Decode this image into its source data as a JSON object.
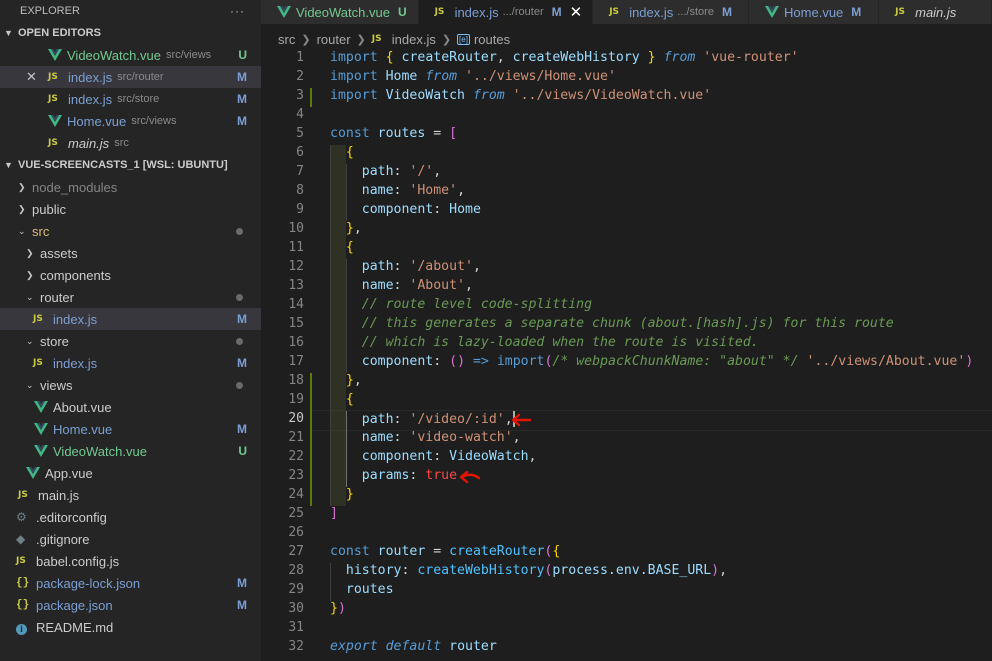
{
  "sidebar": {
    "title": "EXPLORER",
    "more": "···",
    "open_editors": {
      "label": "OPEN EDITORS",
      "items": [
        {
          "name": "VideoWatch.vue",
          "desc": "src/views",
          "badge": "U",
          "icon": "vue-icon"
        },
        {
          "name": "index.js",
          "desc": "src/router",
          "badge": "M",
          "icon": "js-icon"
        },
        {
          "name": "index.js",
          "desc": "src/store",
          "badge": "M",
          "icon": "js-icon"
        },
        {
          "name": "Home.vue",
          "desc": "src/views",
          "badge": "M",
          "icon": "vue-icon"
        },
        {
          "name": "main.js",
          "desc": "src",
          "badge": "",
          "icon": "js-icon"
        }
      ]
    },
    "workspace": {
      "label": "VUE-SCREENCASTS_1 [WSL: UBUNTU]",
      "items": [
        {
          "name": "node_modules"
        },
        {
          "name": "public"
        },
        {
          "name": "src"
        },
        {
          "name": "assets"
        },
        {
          "name": "components"
        },
        {
          "name": "router"
        },
        {
          "name": "index.js",
          "badge": "M"
        },
        {
          "name": "store"
        },
        {
          "name": "index.js",
          "badge": "M"
        },
        {
          "name": "views"
        },
        {
          "name": "About.vue"
        },
        {
          "name": "Home.vue",
          "badge": "M"
        },
        {
          "name": "VideoWatch.vue",
          "badge": "U"
        },
        {
          "name": "App.vue"
        },
        {
          "name": "main.js"
        },
        {
          "name": ".editorconfig"
        },
        {
          "name": ".gitignore"
        },
        {
          "name": "babel.config.js"
        },
        {
          "name": "package-lock.json",
          "badge": "M"
        },
        {
          "name": "package.json",
          "badge": "M"
        },
        {
          "name": "README.md"
        }
      ]
    }
  },
  "tabs": [
    {
      "label": "VideoWatch.vue",
      "ext": "",
      "badge": "U"
    },
    {
      "label": "index.js",
      "ext": ".../router",
      "badge": "M"
    },
    {
      "label": "index.js",
      "ext": ".../store",
      "badge": "M"
    },
    {
      "label": "Home.vue",
      "ext": "",
      "badge": "M"
    },
    {
      "label": "main.js",
      "ext": "",
      "badge": ""
    }
  ],
  "breadcrumb": [
    "src",
    "router",
    "index.js",
    "routes"
  ],
  "editor": {
    "line_numbers": [
      "1",
      "2",
      "3",
      "4",
      "5",
      "6",
      "7",
      "8",
      "9",
      "10",
      "11",
      "12",
      "13",
      "14",
      "15",
      "16",
      "17",
      "18",
      "19",
      "20",
      "21",
      "22",
      "23",
      "24",
      "25",
      "26",
      "27",
      "28",
      "29",
      "30",
      "31",
      "32"
    ],
    "current_line": 20,
    "lines": [
      "import { createRouter, createWebHistory } from 'vue-router'",
      "import Home from '../views/Home.vue'",
      "import VideoWatch from '../views/VideoWatch.vue'",
      "",
      "const routes = [",
      "  {",
      "    path: '/',",
      "    name: 'Home',",
      "    component: Home",
      "  },",
      "  {",
      "    path: '/about',",
      "    name: 'About',",
      "    // route level code-splitting",
      "    // this generates a separate chunk (about.[hash].js) for this route",
      "    // which is lazy-loaded when the route is visited.",
      "    component: () => import(/* webpackChunkName: \"about\" */ '../views/About.vue')",
      "  },",
      "  {",
      "    path: '/video/:id',",
      "    name: 'video-watch',",
      "    component: VideoWatch,",
      "    params: true",
      "  }",
      "]",
      "",
      "const router = createRouter({",
      "  history: createWebHistory(process.env.BASE_URL),",
      "  routes",
      "})",
      "",
      "export default router"
    ]
  },
  "colors": {
    "accent_modified": "#7c9fd3",
    "accent_untracked": "#73c991",
    "arrow": "#e51400"
  }
}
